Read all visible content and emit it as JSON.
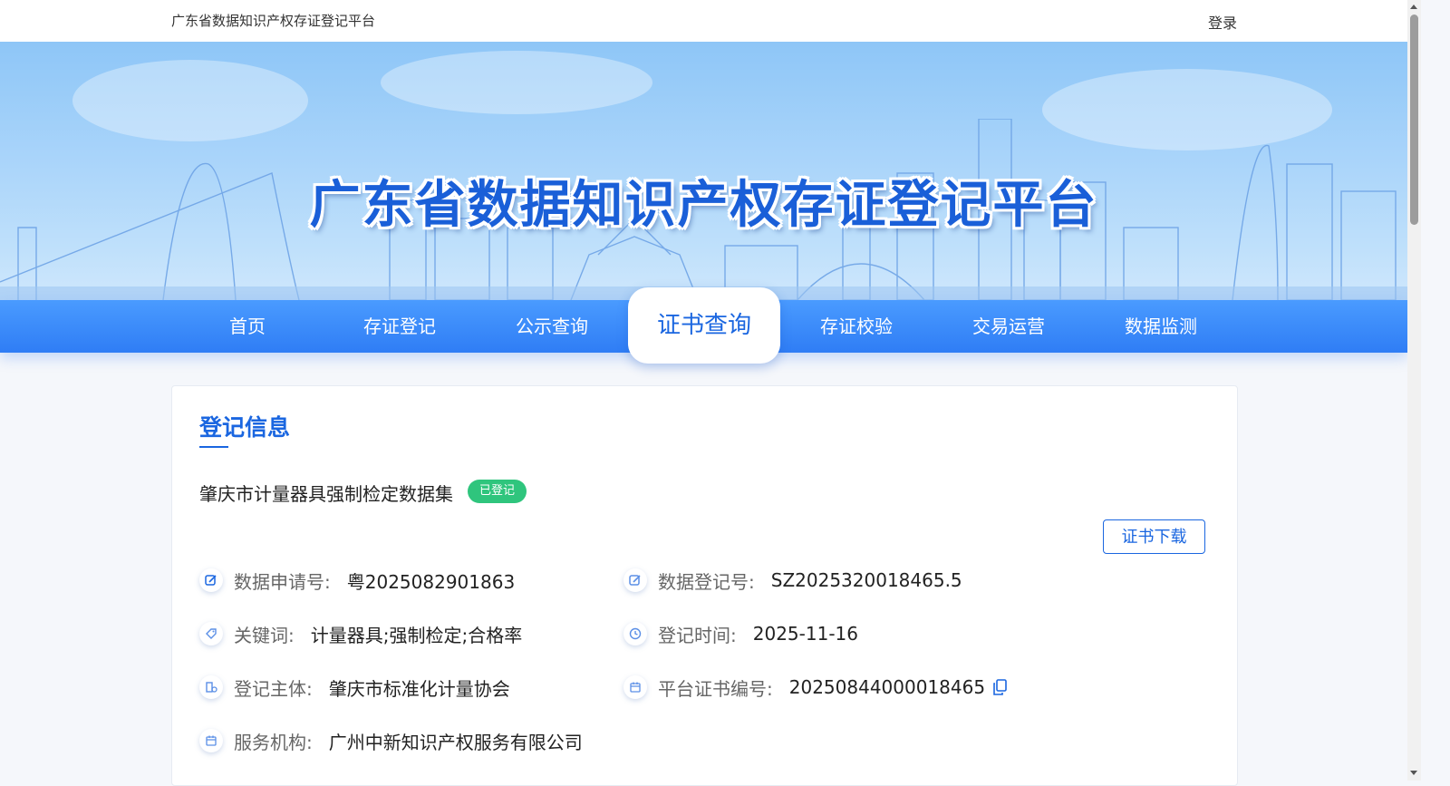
{
  "header": {
    "site_name": "广东省数据知识产权存证登记平台",
    "login": "登录"
  },
  "banner": {
    "title": "广东省数据知识产权存证登记平台"
  },
  "nav": {
    "items": [
      {
        "label": "首页"
      },
      {
        "label": "存证登记"
      },
      {
        "label": "公示查询"
      },
      {
        "label": "证书查询"
      },
      {
        "label": "存证校验"
      },
      {
        "label": "交易运营"
      },
      {
        "label": "数据监测"
      }
    ],
    "active": "证书查询"
  },
  "registration": {
    "section_title": "登记信息",
    "dataset_name": "肇庆市计量器具强制检定数据集",
    "status": "已登记",
    "download_button": "证书下载",
    "fields": {
      "application_no": {
        "label": "数据申请号:",
        "value": "粤2025082901863"
      },
      "registration_no": {
        "label": "数据登记号:",
        "value": "SZ2025320018465.5"
      },
      "keywords": {
        "label": "关键词:",
        "value": "计量器具;强制检定;合格率"
      },
      "registration_time": {
        "label": "登记时间:",
        "value": "2025-11-16"
      },
      "subject": {
        "label": "登记主体:",
        "value": "肇庆市标准化计量协会"
      },
      "certificate_no": {
        "label": "平台证书编号:",
        "value": "20250844000018465"
      },
      "service_org": {
        "label": "服务机构:",
        "value": "广州中新知识产权服务有限公司"
      }
    }
  },
  "colors": {
    "primary": "#1a66e0",
    "nav_bg": "#2f7df5",
    "badge_green": "#2fc57d"
  }
}
